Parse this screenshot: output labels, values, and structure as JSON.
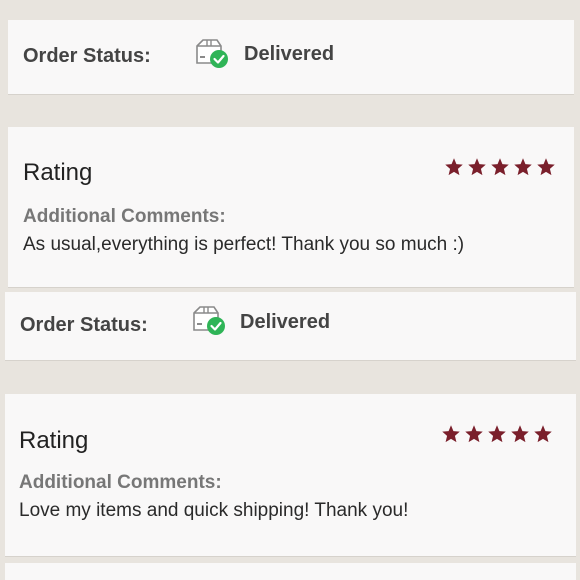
{
  "reviews": [
    {
      "order_status_label": "Order Status:",
      "status_value": "Delivered",
      "rating_title": "Rating",
      "rating_stars": 5,
      "comments_label": "Additional Comments:",
      "comments_text": "As usual,everything is perfect! Thank you so much :)"
    },
    {
      "order_status_label": "Order Status:",
      "status_value": "Delivered",
      "rating_title": "Rating",
      "rating_stars": 5,
      "comments_label": "Additional Comments:",
      "comments_text": "Love my items and quick shipping! Thank you!"
    }
  ],
  "colors": {
    "star": "#7a1f2b",
    "check": "#2fb457",
    "background": "#e8e4de",
    "card": "#f9f8f8"
  },
  "icons": {
    "status": "delivered-box-check-icon",
    "star": "star-icon"
  }
}
